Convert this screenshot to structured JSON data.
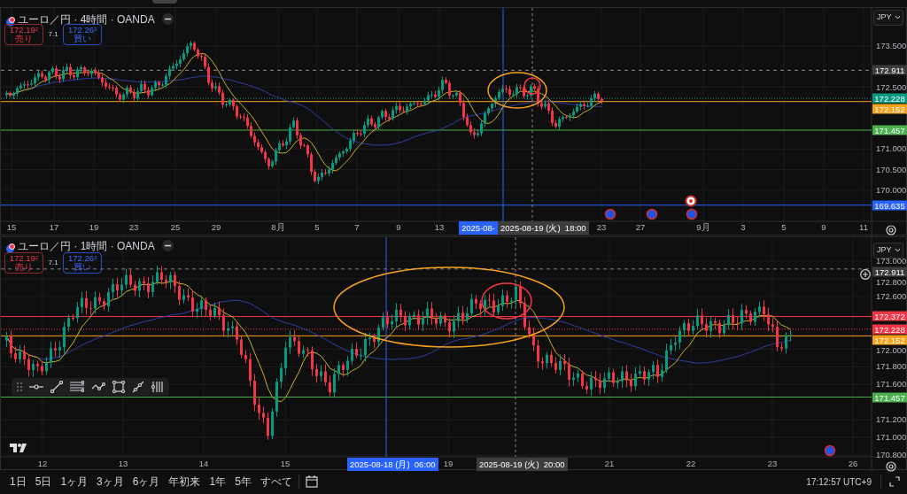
{
  "panes": [
    {
      "title": "ユーロ／円 · 4時間 · OANDA",
      "sell": {
        "price": "172.19$^{2}$",
        "label": "売り"
      },
      "spread": "7.1",
      "buy": {
        "price": "172.26$^{3}$",
        "label": "買い"
      },
      "currency": "JPY",
      "price_ticks": [
        "173.500",
        "172.500",
        "171.000",
        "170.500",
        "170.000"
      ],
      "price_tags": [
        {
          "text": "172.911",
          "color": "#3d3d3d",
          "kind": "dashed"
        },
        {
          "text": "172.228",
          "color": "#089981",
          "kind": "dotted"
        },
        {
          "text": "172.152",
          "color": "#f7a21b",
          "kind": "solid"
        },
        {
          "text": "171.457",
          "color": "#4caf50",
          "kind": "solid"
        },
        {
          "text": "169.635",
          "color": "#2962ff",
          "kind": "solid"
        }
      ],
      "time_labels": [
        "15",
        "17",
        "19",
        "23",
        "25",
        "29",
        "8月",
        "5",
        "7",
        "9",
        "13",
        "23",
        "27",
        "9月",
        "3",
        "5",
        "9",
        "11"
      ],
      "crosshair_labels": [
        {
          "text": "2025-08-",
          "color": "#2962ff"
        },
        {
          "text": "2025-08-19 (火)  18:00",
          "color": "#3d3d3d"
        }
      ]
    },
    {
      "title": "ユーロ／円 · 1時間 · OANDA",
      "sell": {
        "price": "172.19$^{2}$",
        "label": "売り"
      },
      "spread": "7.1",
      "buy": {
        "price": "172.26$^{3}$",
        "label": "買い"
      },
      "currency": "JPY",
      "price_ticks": [
        "173.000",
        "172.800",
        "172.600",
        "172.000",
        "171.800",
        "171.600",
        "171.200",
        "171.000",
        "170.800"
      ],
      "price_tags": [
        {
          "text": "172.911",
          "color": "#3d3d3d",
          "kind": "dashed"
        },
        {
          "text": "172.372",
          "color": "#f23645",
          "kind": "solid"
        },
        {
          "text": "172.228",
          "color": "#f23645",
          "kind": "dotted"
        },
        {
          "text": "172.152",
          "color": "#f7a21b",
          "kind": "solid"
        },
        {
          "text": "171.457",
          "color": "#4caf50",
          "kind": "solid"
        }
      ],
      "time_labels": [
        "12",
        "13",
        "14",
        "15",
        "19",
        "21",
        "22",
        "23",
        "26"
      ],
      "crosshair_labels": [
        {
          "text": "2025-08-18 (月)  06:00",
          "color": "#2962ff"
        },
        {
          "text": "2025-08-19 (火)  20:00",
          "color": "#3d3d3d"
        }
      ]
    }
  ],
  "ranges": [
    "1日",
    "5日",
    "1ヶ月",
    "3ヶ月",
    "6ヶ月",
    "年初来",
    "1年",
    "5年",
    "すべて"
  ],
  "clock": "17:12:57 UTC+9"
}
